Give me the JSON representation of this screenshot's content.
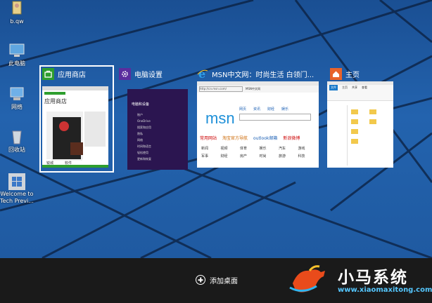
{
  "desktop_icons": [
    {
      "label": "b.qw",
      "icon": "user-folder-icon"
    },
    {
      "label": "此电脑",
      "icon": "computer-icon"
    },
    {
      "label": "网络",
      "icon": "network-icon"
    },
    {
      "label": "回收站",
      "icon": "recycle-bin-icon"
    },
    {
      "label": "Welcome to Tech Previ...",
      "icon": "windows-logo-icon"
    }
  ],
  "windows": [
    {
      "title": "应用商店",
      "icon": "store-icon",
      "icon_color": "#2e9e2e",
      "selected": true,
      "preview": {
        "header": "应用商店",
        "tiles": [
          "锐城",
          "软件"
        ]
      }
    },
    {
      "title": "电脑设置",
      "icon": "gear-icon",
      "icon_color": "#5b2d9e",
      "selected": false,
      "preview": {
        "header": "电脑和设备",
        "items": [
          "账户",
          "OneDrive",
          "搜索和应用",
          "隐私",
          "网络",
          "时间和语言",
          "轻松使用",
          "更新和恢复"
        ]
      }
    },
    {
      "title": "MSN中文网：时尚生活 白领门...",
      "icon": "ie-icon",
      "icon_color": "#1e88e5",
      "selected": false,
      "preview": {
        "address": "http://cn.msn.com/",
        "tab": "MSN中文网",
        "logo": "msn",
        "nav": [
          "网页",
          "资讯",
          "财经",
          "娱乐"
        ],
        "links_row": [
          "常用网站",
          "淘宝官方导航",
          "outlook邮箱",
          "新浪微博"
        ],
        "grid": [
          "新闻",
          "视频",
          "体育",
          "娱乐",
          "汽车",
          "游戏",
          "军事",
          "财经",
          "房产",
          "时尚",
          "旅游",
          "科技"
        ]
      }
    },
    {
      "title": "主页",
      "icon": "home-folder-icon",
      "icon_color": "#e8632a",
      "selected": false,
      "preview": {
        "ribbon": [
          "文件",
          "主页",
          "共享",
          "查看"
        ]
      }
    }
  ],
  "taskview": {
    "add_desktop_label": "添加桌面"
  },
  "brand": {
    "name": "小马系统",
    "url": "www.xiaomaxitong.com",
    "accent": "#55c7ff"
  }
}
